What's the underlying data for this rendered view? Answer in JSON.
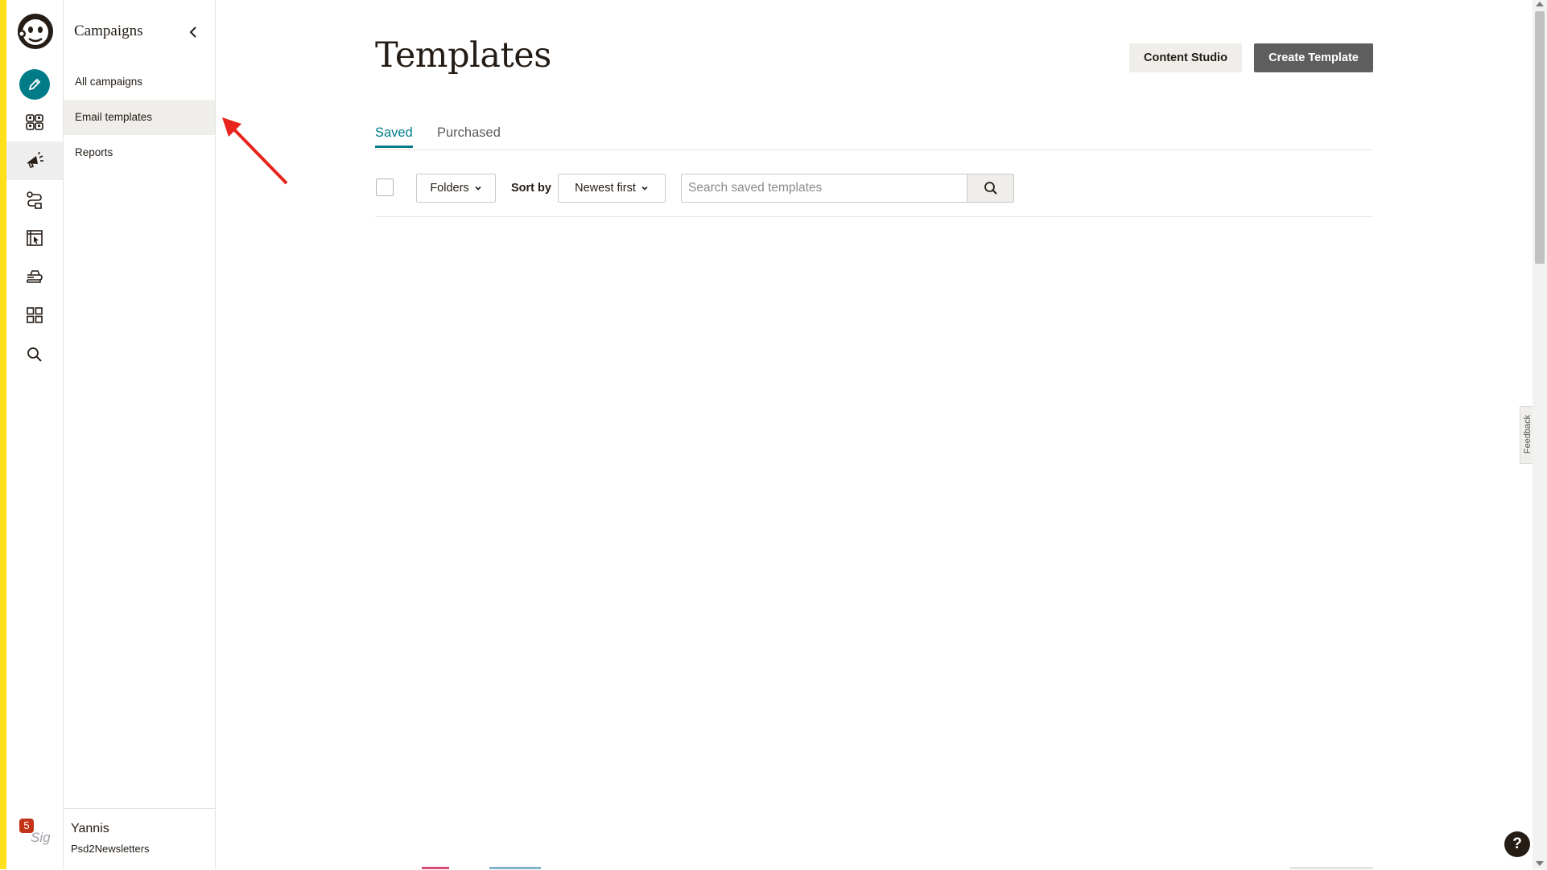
{
  "colors": {
    "accent": "#007c89",
    "brand_yellow": "#ffe01b",
    "primary_button": "#5e5e5e",
    "badge": "#c23317"
  },
  "rail": {
    "items": [
      {
        "name": "create",
        "icon": "pencil-icon"
      },
      {
        "name": "audience",
        "icon": "audience-icon"
      },
      {
        "name": "campaigns",
        "icon": "megaphone-icon"
      },
      {
        "name": "automations",
        "icon": "automation-icon"
      },
      {
        "name": "website",
        "icon": "website-icon"
      },
      {
        "name": "content",
        "icon": "content-icon"
      },
      {
        "name": "integrations",
        "icon": "grid-icon"
      },
      {
        "name": "search",
        "icon": "search-icon"
      }
    ],
    "notification_count": "5",
    "avatar_text": "Sig"
  },
  "subnav": {
    "title": "Campaigns",
    "items": [
      {
        "label": "All campaigns"
      },
      {
        "label": "Email templates"
      },
      {
        "label": "Reports"
      }
    ],
    "user": {
      "name": "Yannis",
      "org": "Psd2Newsletters"
    }
  },
  "main": {
    "title": "Templates",
    "buttons": {
      "content_studio": "Content Studio",
      "create_template": "Create Template"
    },
    "tabs": [
      {
        "label": "Saved"
      },
      {
        "label": "Purchased"
      }
    ],
    "toolbar": {
      "folders_label": "Folders",
      "sort_by_label": "Sort by",
      "sort_value": "Newest first",
      "search_placeholder": "Search saved templates"
    }
  },
  "feedback_label": "Feedback",
  "help_label": "?"
}
